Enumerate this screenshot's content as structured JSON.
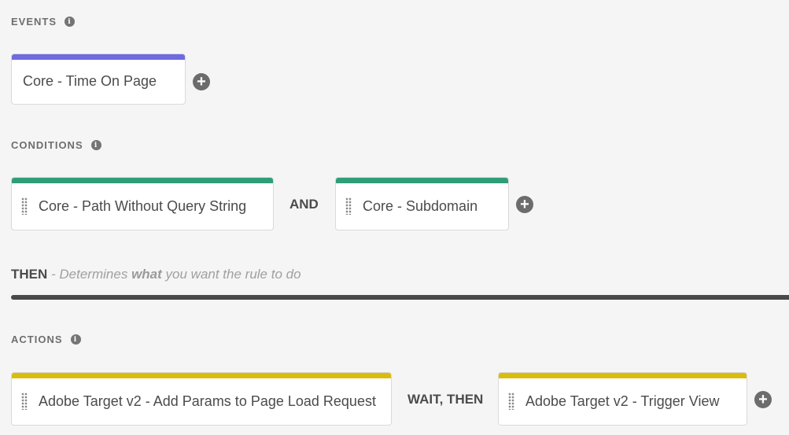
{
  "events": {
    "heading": "EVENTS",
    "info": "i",
    "items": [
      {
        "label": "Core - Time On Page"
      }
    ],
    "add": "+"
  },
  "conditions": {
    "heading": "CONDITIONS",
    "info": "i",
    "items": [
      {
        "label": "Core - Path Without Query String"
      },
      {
        "label": "Core - Subdomain"
      }
    ],
    "connector": "AND",
    "add": "+"
  },
  "then": {
    "keyword": "THEN",
    "desc_prefix": "- Determines",
    "desc_strong": "what",
    "desc_suffix": "you want the rule to do"
  },
  "actions": {
    "heading": "ACTIONS",
    "info": "i",
    "items": [
      {
        "label": "Adobe Target v2 - Add Params to Page Load Request"
      },
      {
        "label": "Adobe Target v2 - Trigger View"
      }
    ],
    "connector": "WAIT, THEN",
    "add": "+"
  },
  "colors": {
    "events": "#6f6ae0",
    "conditions": "#2f9e78",
    "actions": "#d8bd0d"
  }
}
